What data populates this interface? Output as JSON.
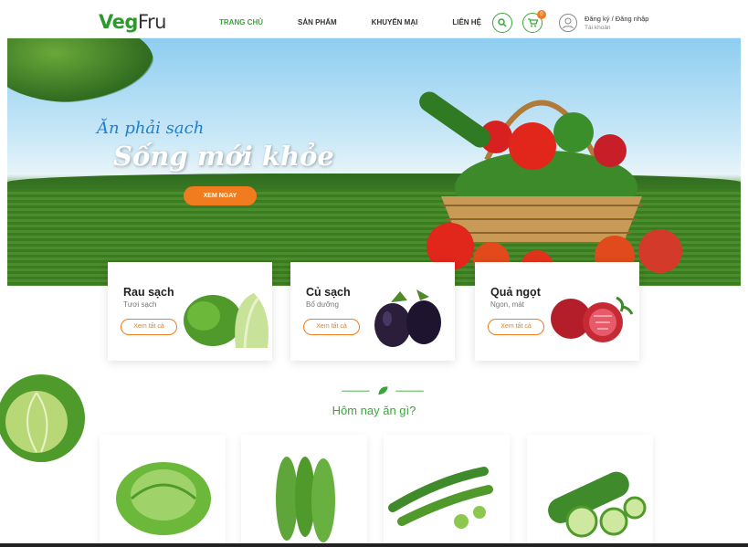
{
  "header": {
    "logo_prefix": "Veg",
    "logo_suffix": "Fru",
    "nav": [
      "TRANG CHỦ",
      "SẢN PHẨM",
      "KHUYẾN MẠI",
      "LIÊN HỆ"
    ],
    "cart_count": "0",
    "account_line1": "Đăng ký / Đăng nhập",
    "account_line2": "Tài khoản"
  },
  "hero": {
    "slogan_line1": "Ăn phải sạch",
    "slogan_line2": "Sống mới khỏe",
    "cta_label": "XEM NGAY"
  },
  "categories": [
    {
      "title": "Rau sạch",
      "subtitle": "Tươi sạch",
      "button": "Xem tất cả"
    },
    {
      "title": "Củ sạch",
      "subtitle": "Bổ dưỡng",
      "button": "Xem tất cả"
    },
    {
      "title": "Quả ngọt",
      "subtitle": "Ngon, mát",
      "button": "Xem tất cả"
    }
  ],
  "section_title": "Hôm nay ăn gì?",
  "colors": {
    "accent_green": "#3aa63a",
    "accent_orange": "#f07c1f"
  },
  "icons": [
    "search-icon",
    "cart-icon",
    "user-icon",
    "leaf-icon"
  ]
}
